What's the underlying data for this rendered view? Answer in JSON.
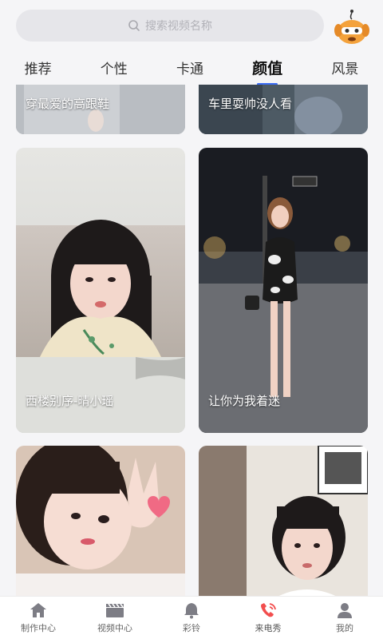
{
  "search": {
    "placeholder": "搜索视频名称"
  },
  "tabs": [
    {
      "label": "推荐"
    },
    {
      "label": "个性"
    },
    {
      "label": "卡通"
    },
    {
      "label": "颜值",
      "active": true
    },
    {
      "label": "风景"
    }
  ],
  "feed": {
    "cards": [
      {
        "title": "穿最爱的高跟鞋"
      },
      {
        "title": "车里耍帅没人看"
      },
      {
        "title": "西楼别序-晴小瑶"
      },
      {
        "title": "让你为我着迷"
      },
      {
        "title": ""
      },
      {
        "title": ""
      }
    ]
  },
  "bottom_nav": [
    {
      "label": "制作中心",
      "icon": "home-icon"
    },
    {
      "label": "视频中心",
      "icon": "clapperboard-icon"
    },
    {
      "label": "彩铃",
      "icon": "bell-icon"
    },
    {
      "label": "来电秀",
      "icon": "phone-icon",
      "accent": "#f24e4e"
    },
    {
      "label": "我的",
      "icon": "user-icon"
    }
  ],
  "colors": {
    "accent": "#3b6cf6",
    "call_red": "#f24e4e"
  }
}
